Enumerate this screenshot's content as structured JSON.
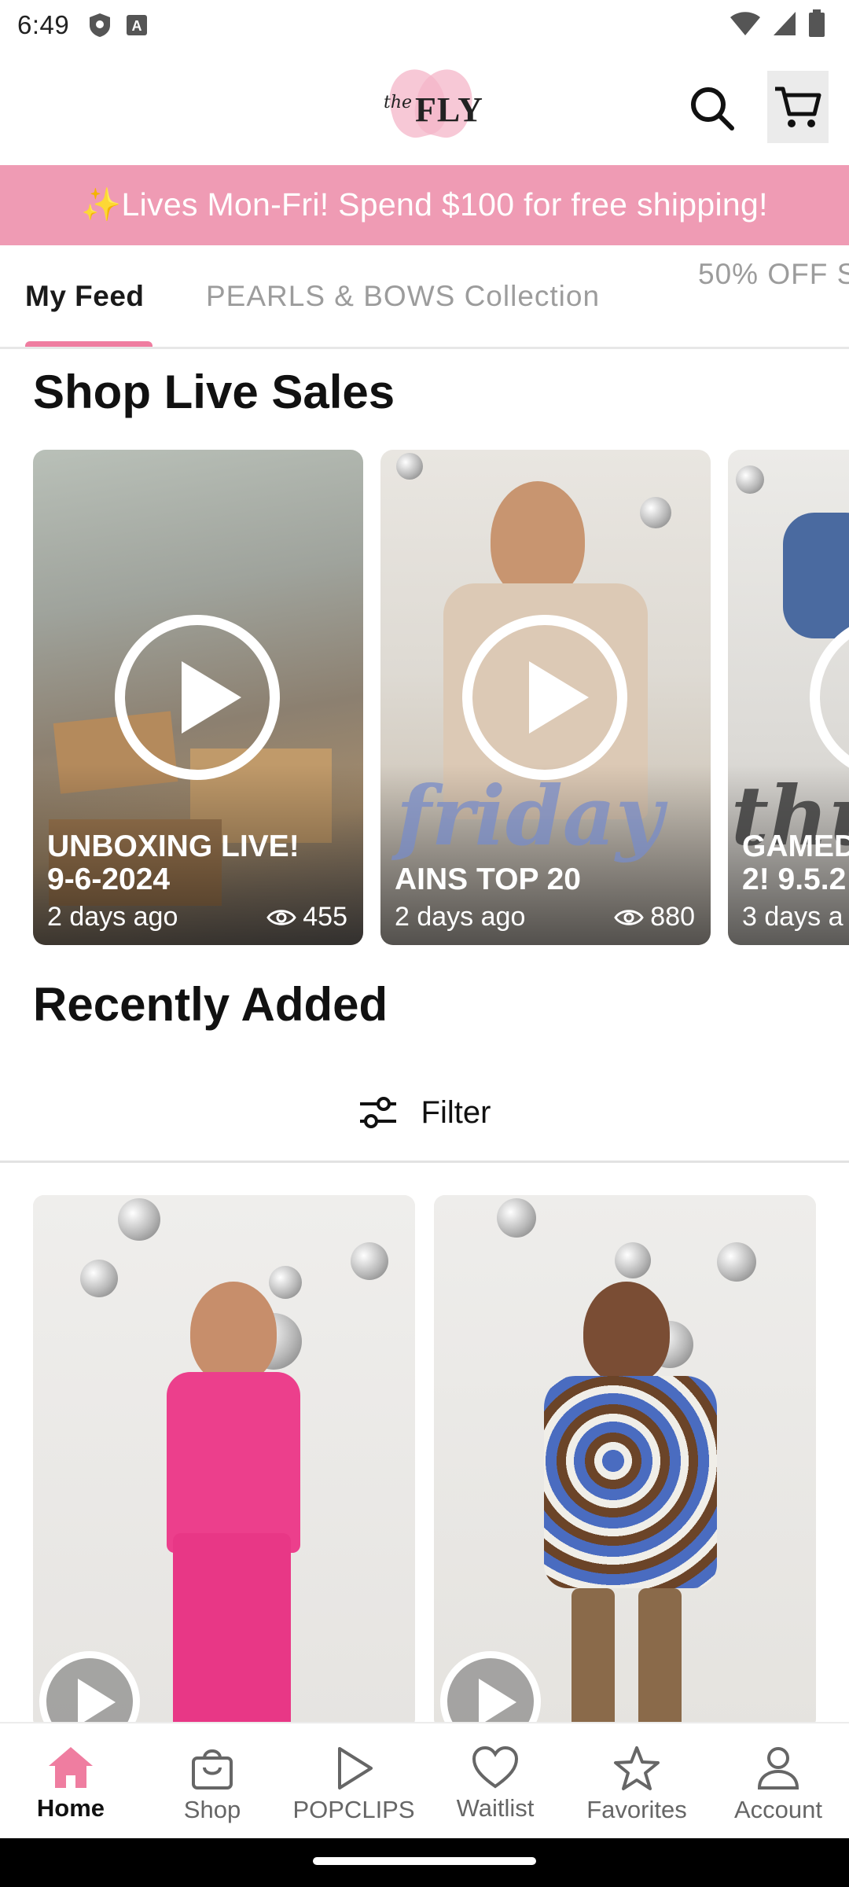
{
  "status_bar": {
    "time": "6:49"
  },
  "header": {
    "logo_text": "FLY",
    "logo_prefix": "the"
  },
  "promo": {
    "text": "✨Lives Mon-Fri! Spend $100 for free shipping!"
  },
  "tabs": [
    {
      "label": "My Feed",
      "active": true
    },
    {
      "label": "PEARLS & BOWS Collection",
      "active": false
    },
    {
      "label": "50% OFF S",
      "active": false
    }
  ],
  "live_sales": {
    "title": "Shop Live Sales",
    "cards": [
      {
        "title": "UNBOXING LIVE!\n9-6-2024",
        "age": "2 days ago",
        "views": "455"
      },
      {
        "title": "AINS TOP 20",
        "age": "2 days ago",
        "views": "880",
        "overlay_text": "friday"
      },
      {
        "title": "GAMED\n2! 9.5.2",
        "age": "3 days a",
        "overlay_text": "thu"
      }
    ]
  },
  "recently_added": {
    "title": "Recently Added",
    "filter_label": "Filter"
  },
  "bottom_nav": [
    {
      "label": "Home",
      "icon": "home-icon",
      "active": true
    },
    {
      "label": "Shop",
      "icon": "shopping-bag-icon",
      "active": false
    },
    {
      "label": "POPCLIPS",
      "icon": "play-icon",
      "active": false
    },
    {
      "label": "Waitlist",
      "icon": "heart-icon",
      "active": false
    },
    {
      "label": "Favorites",
      "icon": "star-icon",
      "active": false
    },
    {
      "label": "Account",
      "icon": "person-icon",
      "active": false
    }
  ],
  "colors": {
    "brand_pink": "#ef9bb4",
    "tab_indicator": "#ef7da0",
    "home_active": "#ef7da0"
  }
}
